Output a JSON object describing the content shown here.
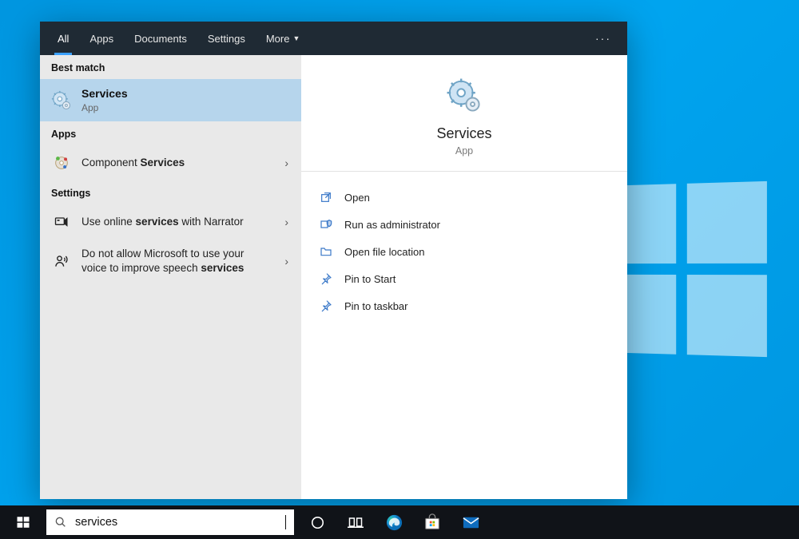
{
  "tabs": {
    "all": "All",
    "apps": "Apps",
    "documents": "Documents",
    "settings": "Settings",
    "more": "More"
  },
  "left": {
    "best_match_label": "Best match",
    "best_match": {
      "title": "Services",
      "subtitle": "App"
    },
    "apps_label": "Apps",
    "apps": [
      {
        "title_pre": "Component ",
        "title_bold": "Services"
      }
    ],
    "settings_label": "Settings",
    "settings": [
      {
        "title_pre": "Use online ",
        "title_bold": "services",
        "title_post": " with Narrator"
      },
      {
        "title_pre": "Do not allow Microsoft to use your voice to improve speech ",
        "title_bold": "services",
        "title_post": ""
      }
    ]
  },
  "detail": {
    "title": "Services",
    "subtitle": "App",
    "actions": {
      "open": "Open",
      "run_admin": "Run as administrator",
      "open_loc": "Open file location",
      "pin_start": "Pin to Start",
      "pin_taskbar": "Pin to taskbar"
    }
  },
  "search": {
    "value": "services"
  }
}
